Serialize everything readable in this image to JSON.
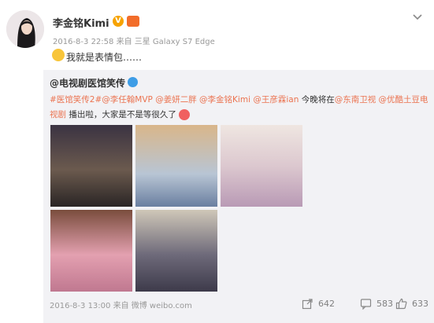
{
  "post": {
    "username": "李金铭Kimi",
    "meta": "2016-8-3 22:58 来自 三星 Galaxy S7 Edge",
    "text": "我就是表情包……"
  },
  "repost": {
    "author": "@电视剧医馆笑传",
    "text_parts": {
      "t1": "#医馆笑传2#",
      "t2": "@李任翰MVP",
      "t3": "@姜妍二胖",
      "t4": "@李金铭Kimi",
      "t5": "@王彦霖ian",
      "p1": " 今晚将在",
      "t6": "@东南卫视",
      "t7": "@优酷土豆电视剧",
      "p2": " 播出啦，大家是不是等很久了"
    },
    "meta": "2016-8-3 13:00 来自 微博 weibo.com",
    "actions": {
      "repost_count": "642",
      "comment_count": "583",
      "like_count": "633"
    }
  },
  "colors": {
    "link": "#eb7350",
    "repost_bg": "#f2f2f5",
    "verify_orange": "#f7a300",
    "verify_blue": "#3e9de6"
  },
  "icons": [
    "avatar",
    "verified-badge",
    "level-badge",
    "chevron-down-icon",
    "emoji-icon",
    "heart-emoji-icon",
    "repost-icon",
    "comment-icon",
    "like-icon"
  ]
}
